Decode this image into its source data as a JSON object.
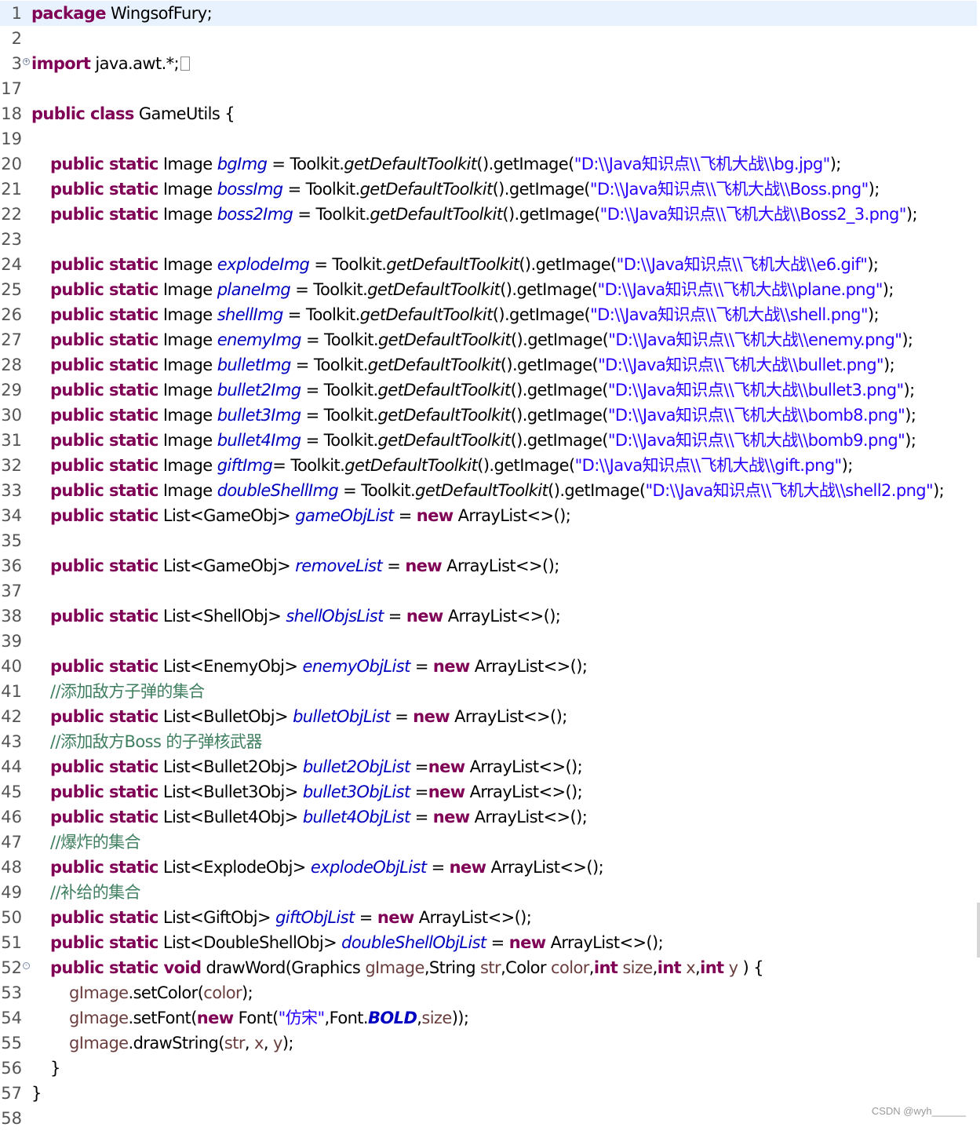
{
  "editor": {
    "package_line": {
      "num": "1",
      "kw": "package",
      "text": " WingsofFury;"
    },
    "blank_lines": [
      "2",
      "17",
      "19",
      "23",
      "35",
      "37",
      "39"
    ],
    "import_line": {
      "num": "3",
      "kw": "import",
      "text": " java.awt.*;"
    },
    "class_line": {
      "num": "18",
      "kw": "public class",
      "text": " GameUtils {"
    },
    "image_fields": [
      {
        "num": "20",
        "name": "bgImg",
        "path": "\"D:\\\\Java知识点\\\\飞机大战\\\\bg.jpg\"",
        "tail": ");"
      },
      {
        "num": "21",
        "name": "bossImg",
        "path": "\"D:\\\\Java知识点\\\\飞机大战\\\\Boss.png\"",
        "tail": ");"
      },
      {
        "num": "22",
        "name": "boss2Img",
        "path": "\"D:\\\\Java知识点\\\\飞机大战\\\\Boss2_3.png\"",
        "tail": ");"
      },
      {
        "num": "24",
        "name": "explodeImg",
        "path": "\"D:\\\\Java知识点\\\\飞机大战\\\\e6.gif\"",
        "tail": ");"
      },
      {
        "num": "25",
        "name": "planeImg",
        "path": "\"D:\\\\Java知识点\\\\飞机大战\\\\plane.png\"",
        "tail": ");"
      },
      {
        "num": "26",
        "name": "shellImg",
        "path": "\"D:\\\\Java知识点\\\\飞机大战\\\\shell.png\"",
        "tail": ");"
      },
      {
        "num": "27",
        "name": "enemyImg",
        "path": "\"D:\\\\Java知识点\\\\飞机大战\\\\enemy.png\"",
        "tail": ");"
      },
      {
        "num": "28",
        "name": "bulletImg",
        "path": "\"D:\\\\Java知识点\\\\飞机大战\\\\bullet.png\"",
        "tail": ");"
      },
      {
        "num": "29",
        "name": "bullet2Img",
        "path": "\"D:\\\\Java知识点\\\\飞机大战\\\\bullet3.png\"",
        "tail": ");"
      },
      {
        "num": "30",
        "name": "bullet3Img",
        "path": "\"D:\\\\Java知识点\\\\飞机大战\\\\bomb8.png\"",
        "tail": ");"
      },
      {
        "num": "31",
        "name": "bullet4Img",
        "path": "\"D:\\\\Java知识点\\\\飞机大战\\\\bomb9.png\"",
        "tail": ");"
      },
      {
        "num": "32",
        "name": "giftImg",
        "path": "\"D:\\\\Java知识点\\\\飞机大战\\\\gift.png\"",
        "tail": ");"
      },
      {
        "num": "33",
        "name": "doubleShellImg",
        "path": "\"D:\\\\Java知识点\\\\飞机大战\\\\shell2.png\"",
        "tail": ");"
      }
    ],
    "list_fields": [
      {
        "num": "34",
        "type": "GameObj",
        "name": "gameObjList"
      },
      {
        "num": "36",
        "type": "GameObj",
        "name": "removeList"
      },
      {
        "num": "38",
        "type": "ShellObj",
        "name": "shellObjsList"
      },
      {
        "num": "40",
        "type": "EnemyObj",
        "name": "enemyObjList"
      },
      {
        "num": "42",
        "type": "BulletObj",
        "name": "bulletObjList"
      },
      {
        "num": "44",
        "type": "Bullet2Obj",
        "name": "bullet2ObjList"
      },
      {
        "num": "45",
        "type": "Bullet3Obj",
        "name": "bullet3ObjList"
      },
      {
        "num": "46",
        "type": "Bullet4Obj",
        "name": "bullet4ObjList"
      },
      {
        "num": "48",
        "type": "ExplodeObj",
        "name": "explodeObjList"
      },
      {
        "num": "50",
        "type": "GiftObj",
        "name": "giftObjList"
      },
      {
        "num": "51",
        "type": "DoubleShellObj",
        "name": "doubleShellObjList"
      }
    ],
    "comments": [
      {
        "num": "41",
        "text": "//添加敌方子弹的集合"
      },
      {
        "num": "43",
        "text": "//添加敌方Boss 的子弹核武器"
      },
      {
        "num": "47",
        "text": "//爆炸的集合"
      },
      {
        "num": "49",
        "text": "//补给的集合"
      }
    ],
    "tokens": {
      "public_static": "public static",
      "image_type": " Image ",
      "toolkit_prefix": " = Toolkit.",
      "get_default_toolkit": "getDefaultToolkit",
      "get_image": "().getImage(",
      "list_prefix": " List<",
      "new_kw": "new",
      "array_list": " ArrayList<>();"
    },
    "method": {
      "num": "52",
      "signature_kw": "public static void",
      "name": " drawWord(",
      "p1_type": "Graphics ",
      "p1": "gImage",
      "p2_type": ",String ",
      "p2": "str",
      "p3_type": ",Color ",
      "p3": "color",
      "int_kw": "int",
      "p4": "size",
      "p5": "x",
      "p6": "y",
      "close": " ) {"
    },
    "body": [
      {
        "num": "53",
        "obj": "gImage",
        "call": ".setColor(",
        "arg": "color",
        "end": ");"
      },
      {
        "num": "55",
        "obj": "gImage",
        "call": ".drawString(",
        "arg": "str",
        "end": ");"
      }
    ],
    "set_font": {
      "num": "54",
      "obj": "gImage",
      "call": ".setFont(",
      "new_kw": "new",
      "font": " Font(",
      "str": "\"仿宋\"",
      "font_cls": ",Font.",
      "bold": "BOLD",
      "size": "size",
      "end": "));"
    },
    "close_method": {
      "num": "56",
      "text": "}"
    },
    "close_class": {
      "num": "57",
      "text": "}"
    },
    "last_num": "58"
  },
  "watermark": "CSDN @wyh______"
}
